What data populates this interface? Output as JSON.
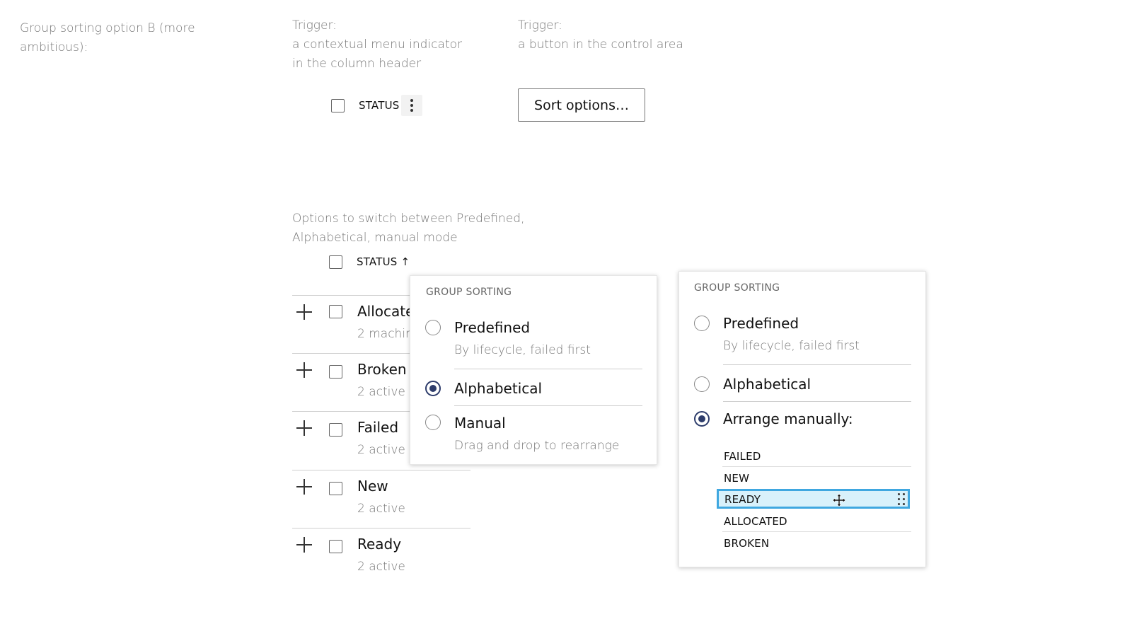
{
  "intro": {
    "line1": "Group sorting option B (more",
    "line2": "ambitious):"
  },
  "trigger_a": {
    "line1": "Trigger:",
    "line2": "a contextual menu indicator",
    "line3": "in the column header",
    "header_label": "STATUS",
    "menu_icon": "vertical-ellipsis-icon"
  },
  "trigger_b": {
    "line1": "Trigger:",
    "line2": "a button in the control area",
    "button_label": "Sort options…"
  },
  "options_note": {
    "line1": "Options to switch between Predefined,",
    "line2": "Alphabetical, manual mode"
  },
  "table": {
    "header_label": "STATUS ↑",
    "rows": [
      {
        "name": "Allocated",
        "sub": "2 machines"
      },
      {
        "name": "Broken",
        "sub": "2 active"
      },
      {
        "name": "Failed",
        "sub": "2 active"
      },
      {
        "name": "New",
        "sub": "2 active"
      },
      {
        "name": "Ready",
        "sub": "2 active"
      }
    ]
  },
  "popover_left": {
    "title": "GROUP SORTING",
    "options": [
      {
        "label": "Predefined",
        "sub": "By lifecycle, failed first",
        "selected": false
      },
      {
        "label": "Alphabetical",
        "sub": "",
        "selected": true
      },
      {
        "label": "Manual",
        "sub": "Drag and drop to rearrange",
        "selected": false
      }
    ]
  },
  "popover_right": {
    "title": "GROUP SORTING",
    "options": [
      {
        "label": "Predefined",
        "sub": "By lifecycle, failed first",
        "selected": false
      },
      {
        "label": "Alphabetical",
        "sub": "",
        "selected": false
      },
      {
        "label": "Arrange manually:",
        "sub": "",
        "selected": true
      }
    ],
    "manual_items": [
      "FAILED",
      "NEW",
      "READY",
      "ALLOCATED",
      "BROKEN"
    ],
    "dragging_item": "READY"
  },
  "colors": {
    "radio_selected": "#2d3c6b",
    "drag_highlight_bg": "#d8f1fb",
    "drag_highlight_border": "#3fa7e0"
  }
}
